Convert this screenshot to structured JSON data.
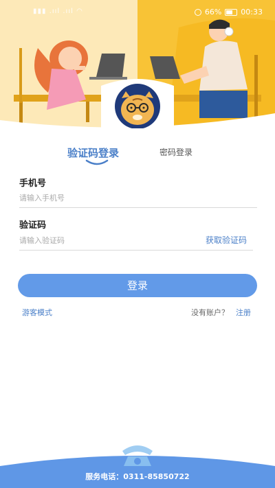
{
  "status_bar": {
    "left_text": "▮▮▮ .ııl .ııl ◠",
    "battery_percent": "66%",
    "time": "00:33"
  },
  "tabs": [
    {
      "label": "验证码登录",
      "active": true
    },
    {
      "label": "密码登录",
      "active": false
    }
  ],
  "phone_field": {
    "label": "手机号",
    "placeholder": "请输入手机号",
    "value": ""
  },
  "code_field": {
    "label": "验证码",
    "placeholder": "请输入验证码",
    "value": ""
  },
  "get_code_label": "获取验证码",
  "login_button_label": "登录",
  "guest_mode_label": "游客模式",
  "no_account_label": "没有账户？",
  "register_label": "注册",
  "footer": {
    "service_phone": "服务电话：0311-85850722"
  },
  "colors": {
    "accent_blue": "#629ae8",
    "link_blue": "#4a7fc8",
    "hero_yellow": "#f6c02e",
    "footer_blue": "#5f97e6"
  }
}
